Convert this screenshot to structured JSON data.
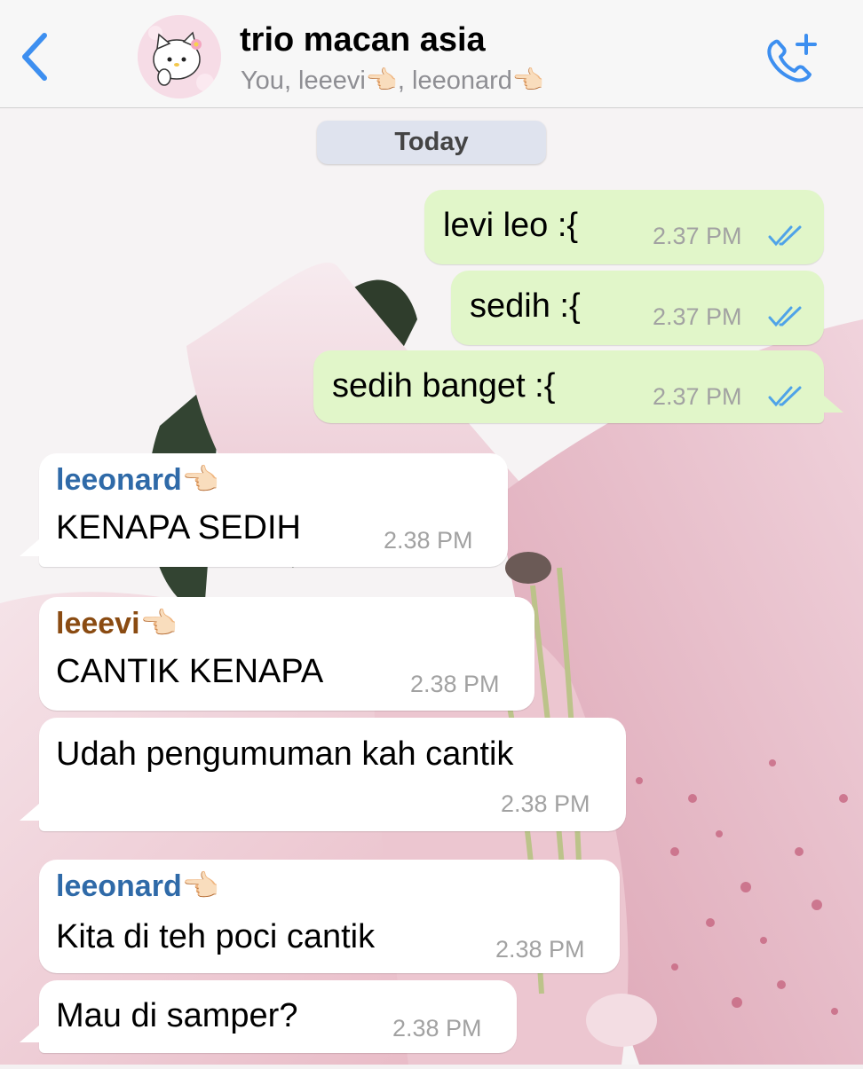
{
  "header": {
    "back_icon": "chevron-left-icon",
    "title": "trio macan asia",
    "subtitle": "You, leeevi👈🏻, leeonard👈🏻",
    "call_icon": "add-call-icon",
    "accent": "#3d8ff0"
  },
  "date_separator": "Today",
  "messages": [
    {
      "direction": "outgoing",
      "text": "levi leo :{",
      "time": "2.37 PM",
      "status": "read"
    },
    {
      "direction": "outgoing",
      "text": "sedih :{",
      "time": "2.37 PM",
      "status": "read"
    },
    {
      "direction": "outgoing",
      "text": "sedih banget :{",
      "time": "2.37 PM",
      "status": "read"
    },
    {
      "direction": "incoming",
      "sender": "leeonard👈🏻",
      "sender_color": "#2f6aa8",
      "text": "KENAPA SEDIH",
      "time": "2.38 PM"
    },
    {
      "direction": "incoming",
      "sender": "leeevi👈🏻",
      "sender_color": "#8a4b12",
      "text": "CANTIK KENAPA",
      "time": "2.38 PM"
    },
    {
      "direction": "incoming",
      "text": "Udah pengumuman kah cantik",
      "time": "2.38 PM"
    },
    {
      "direction": "incoming",
      "sender": "leeonard👈🏻",
      "sender_color": "#2f6aa8",
      "text": "Kita di teh poci cantik",
      "time": "2.38 PM"
    },
    {
      "direction": "incoming",
      "text": "Mau di samper?",
      "time": "2.38 PM"
    }
  ],
  "colors": {
    "outgoing_bubble": "#e1f6c9",
    "incoming_bubble": "#ffffff",
    "read_ticks": "#4fa3e8",
    "timestamp": "#a2a2a2"
  }
}
